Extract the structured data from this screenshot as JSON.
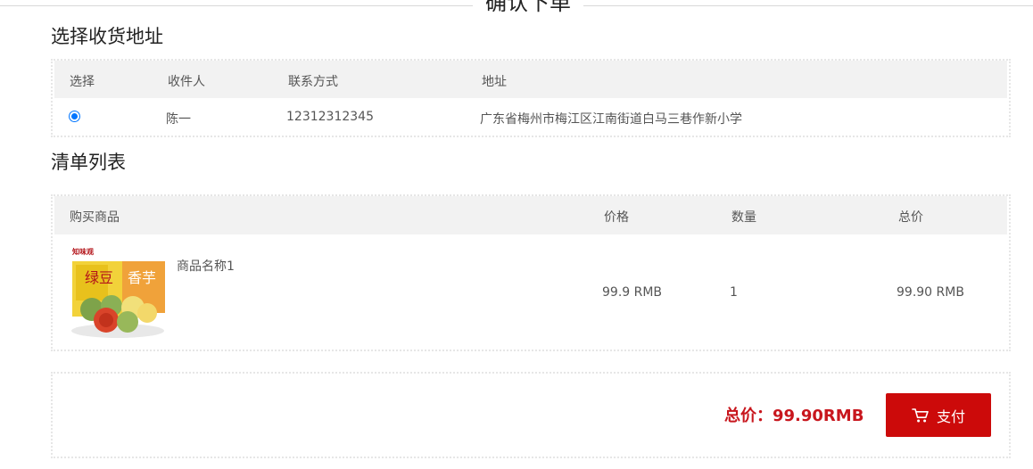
{
  "page": {
    "title": "确认下单"
  },
  "address_section": {
    "title": "选择收货地址",
    "columns": [
      "选择",
      "收件人",
      "联系方式",
      "地址"
    ],
    "rows": [
      {
        "selected": true,
        "recipient": "陈一",
        "phone": "12312312345",
        "address": "广东省梅州市梅江区江南街道白马三巷作新小学"
      }
    ]
  },
  "order_section": {
    "title": "清单列表",
    "columns": [
      "购买商品",
      "价格",
      "数量",
      "总价"
    ],
    "items": [
      {
        "name": "商品名称1",
        "image_icon": "mooncake-product-image",
        "image_brand_text": "知味观",
        "image_text": [
          "绿豆",
          "香芋"
        ],
        "price": "99.9 RMB",
        "quantity": "1",
        "subtotal": "99.90 RMB"
      }
    ]
  },
  "summary": {
    "total_label": "总价：99.90RMB",
    "pay_button_label": "支付",
    "pay_icon": "shopping-cart-icon"
  },
  "colors": {
    "accent": "#cc0a0a",
    "total_text": "#c8161d",
    "header_bg": "#f2f2f2",
    "radio": "#0075ff"
  }
}
